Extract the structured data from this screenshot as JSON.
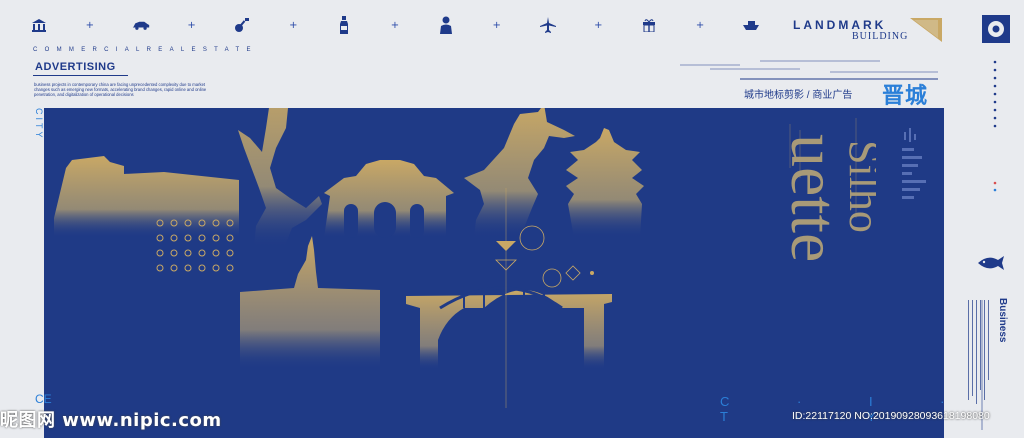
{
  "header": {
    "logo_title": "LANDMARK",
    "logo_subtitle": "BUILDING",
    "icons": [
      "building-icon",
      "car-icon",
      "guitar-icon",
      "bottle-icon",
      "person-icon",
      "airplane-icon",
      "gift-icon",
      "boat-icon"
    ]
  },
  "left_info": {
    "commercial": "COMMERCIALREALESTATE",
    "advertising": "ADVERTISING",
    "description": "business projects in contemporary china are facing unprecedented complexity due to market changes such as emerging new formats, accelerating brand changes, rapid online and online penetration, and digitalization of operational decisions"
  },
  "titles": {
    "cn_subtitle": "城市地标剪影 / 商业广告",
    "cn_city": "晋城",
    "silhouette_top": "Silho",
    "silhouette_bottom": "uette",
    "city_vertical": "CITY",
    "city_bottom": "C · I · T · Y",
    "ce_left": "CE",
    "business": "Business"
  },
  "watermark": {
    "site": "昵图网 www.nipic.com",
    "id": "ID:22117120 NO:20190928093618198080"
  },
  "colors": {
    "background": "#e9ebef",
    "panel": "#1f3a86",
    "gold": "#c9a865",
    "accent_blue": "#2b7fd8",
    "dark_blue": "#1f3a8a"
  }
}
